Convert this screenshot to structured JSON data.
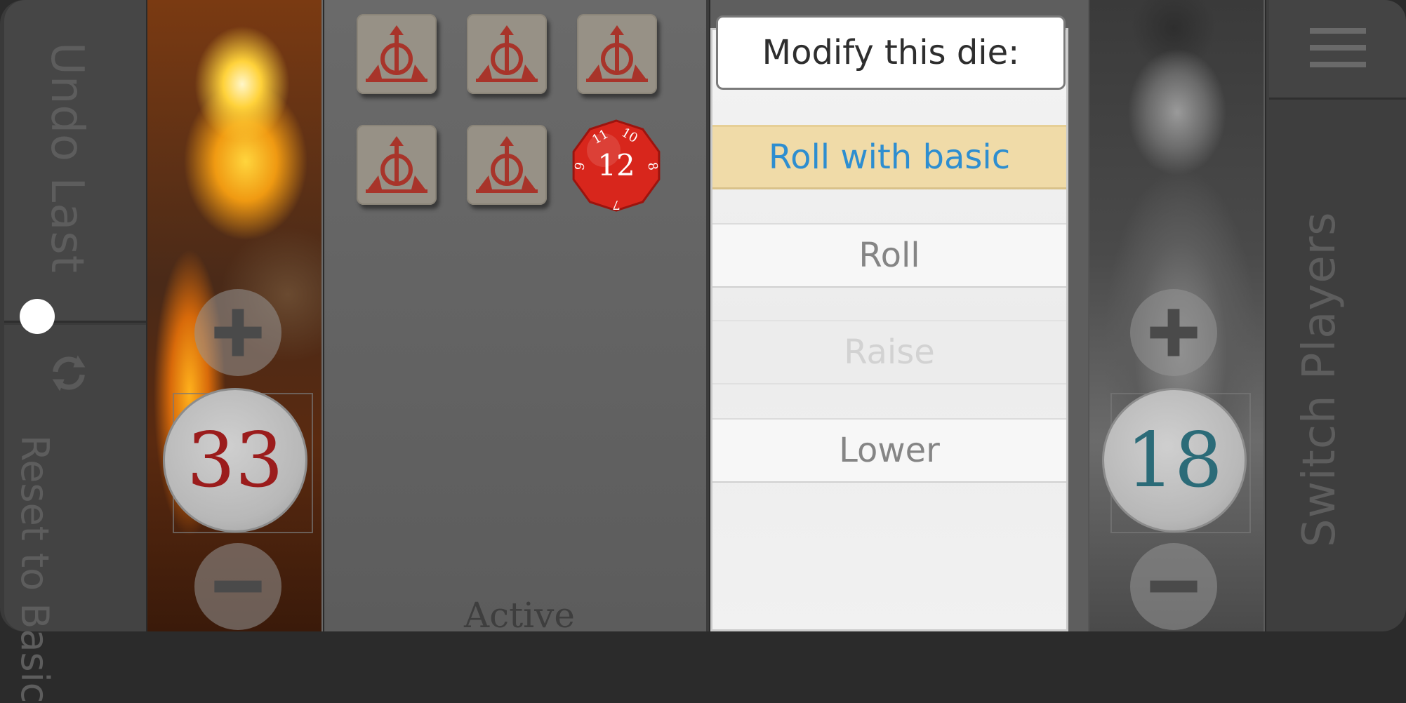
{
  "left_controls": {
    "undo_label": "Undo Last",
    "reset_label": "Reset to Basic",
    "reset_icon": "cycle-arrows-icon"
  },
  "player1": {
    "life": "33",
    "life_color": "#9b1c1c",
    "plus_icon": "plus-icon",
    "minus_icon": "minus-icon"
  },
  "player2": {
    "life": "18",
    "life_color": "#2b6b78",
    "plus_icon": "plus-icon",
    "minus_icon": "minus-icon"
  },
  "dice_tray": {
    "basic_dice_count": 5,
    "basic_die_icon": "basic-die-symbol-icon",
    "special_die": {
      "value": "12",
      "small_faces": [
        "11",
        "10",
        "9",
        "8",
        "7"
      ],
      "color": "#d8261c"
    },
    "status_label": "Active"
  },
  "modify_panel": {
    "title": "Modify this die:",
    "options": [
      {
        "label": "Roll with basic",
        "state": "highlighted"
      },
      {
        "label": "Roll",
        "state": "enabled"
      },
      {
        "label": "Raise",
        "state": "disabled"
      },
      {
        "label": "Lower",
        "state": "enabled"
      }
    ]
  },
  "right_controls": {
    "menu_icon": "hamburger-menu-icon",
    "switch_label": "Switch Players"
  }
}
